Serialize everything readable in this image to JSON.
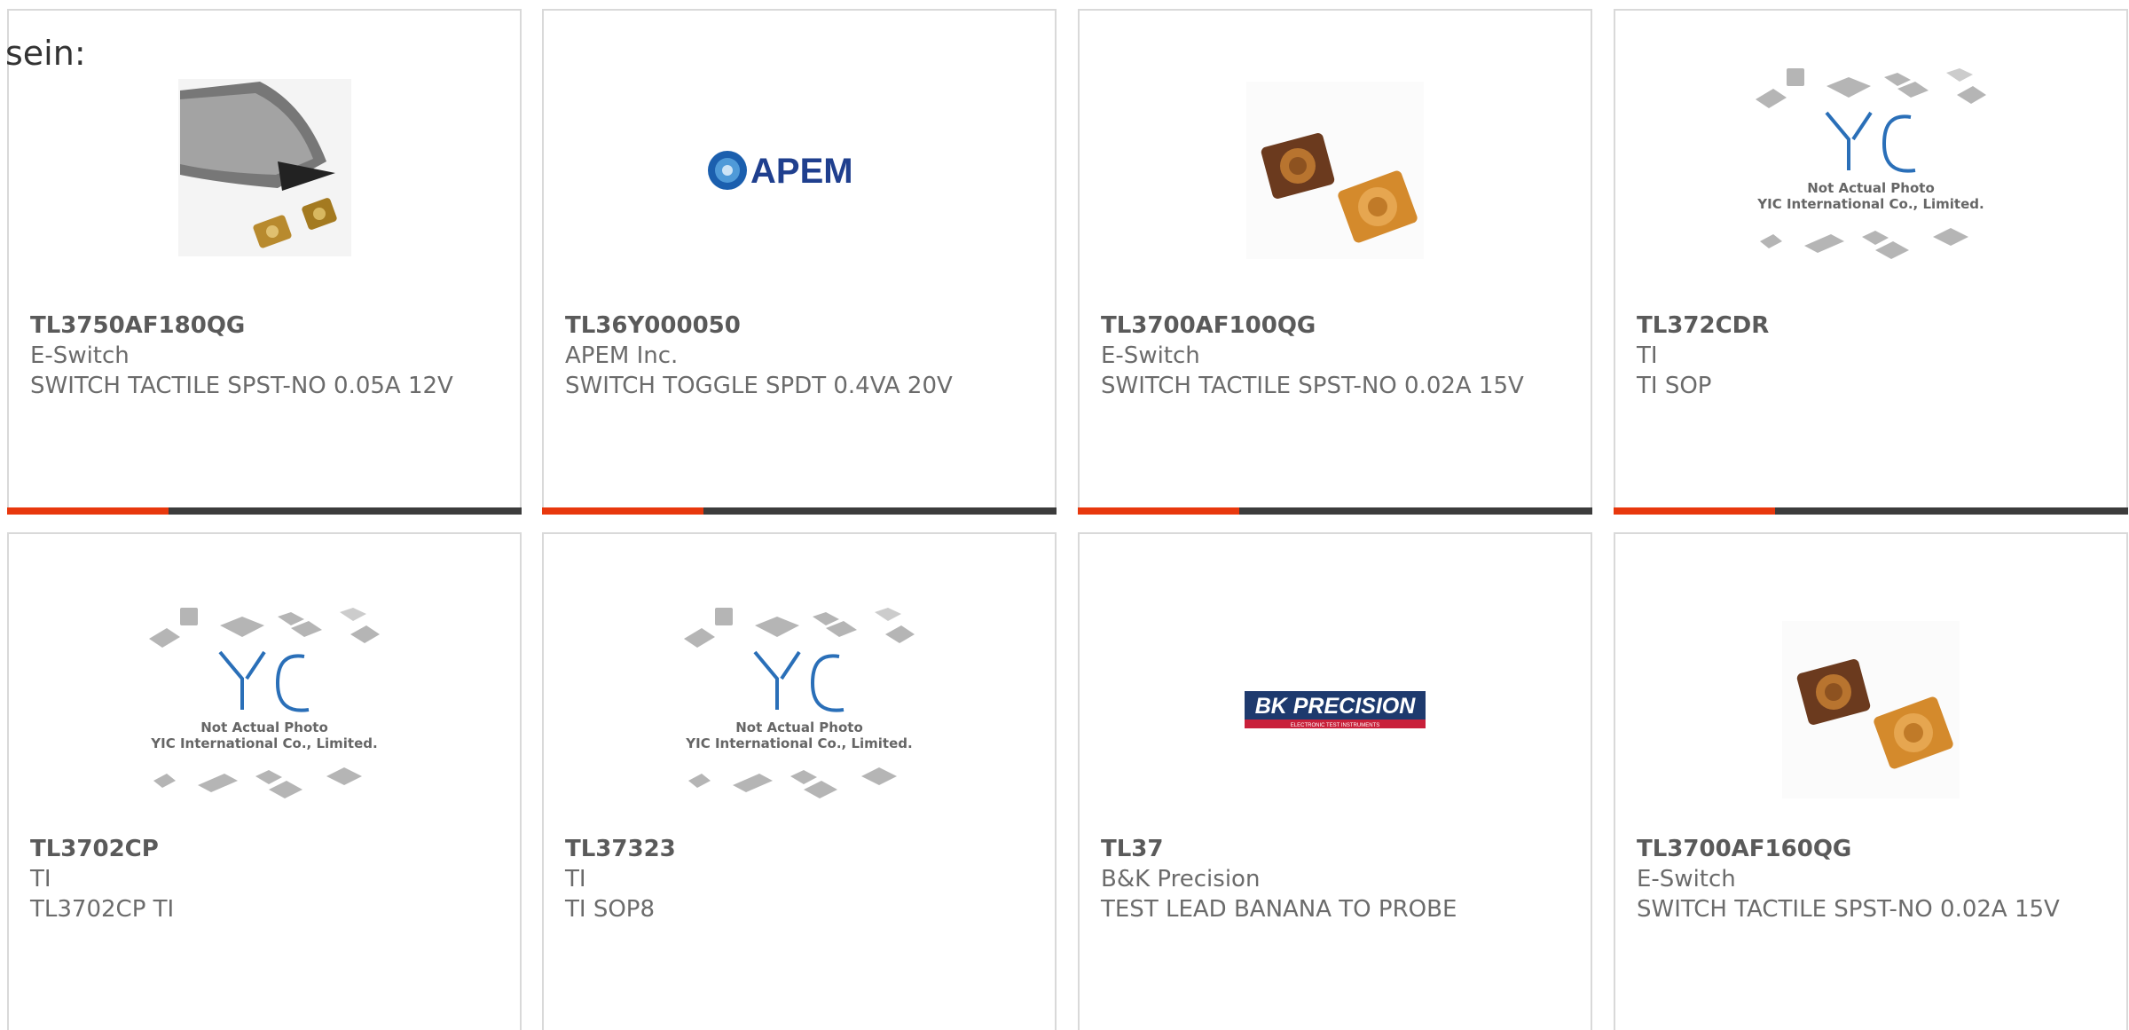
{
  "intro_text": "sein:",
  "colors": {
    "accent": "#e8380d",
    "bar": "#3c3c3c",
    "border": "#d9d9d9",
    "text": "#6b6b6b"
  },
  "cards": [
    {
      "part": "TL3750AF180QG",
      "maker": "E-Switch",
      "desc": "SWITCH TACTILE SPST-NO 0.05A 12V",
      "image": "tactile-switch-with-pen-photo"
    },
    {
      "part": "TL36Y000050",
      "maker": "APEM Inc.",
      "desc": "SWITCH TOGGLE SPDT 0.4VA 20V",
      "image": "apem-logo",
      "logo_text": "APEM"
    },
    {
      "part": "TL3700AF100QG",
      "maker": "E-Switch",
      "desc": "SWITCH TACTILE SPST-NO 0.02A 15V",
      "image": "tactile-switch-photo"
    },
    {
      "part": "TL372CDR",
      "maker": "TI",
      "desc": "TI SOP",
      "image": "yic-placeholder",
      "placeholder_line1": "Not Actual Photo",
      "placeholder_line2": "YIC International Co., Limited."
    },
    {
      "part": "TL3702CP",
      "maker": "TI",
      "desc": "TL3702CP TI",
      "image": "yic-placeholder",
      "placeholder_line1": "Not Actual Photo",
      "placeholder_line2": "YIC International Co., Limited."
    },
    {
      "part": "TL37323",
      "maker": "TI",
      "desc": "TI SOP8",
      "image": "yic-placeholder",
      "placeholder_line1": "Not Actual Photo",
      "placeholder_line2": "YIC International Co., Limited."
    },
    {
      "part": "TL37",
      "maker": "B&K Precision",
      "desc": "TEST LEAD BANANA TO PROBE",
      "image": "bk-precision-logo",
      "logo_text": "BK PRECISION",
      "logo_sub": "ELECTRONIC TEST INSTRUMENTS"
    },
    {
      "part": "TL3700AF160QG",
      "maker": "E-Switch",
      "desc": "SWITCH TACTILE SPST-NO 0.02A 15V",
      "image": "tactile-switch-photo"
    }
  ]
}
